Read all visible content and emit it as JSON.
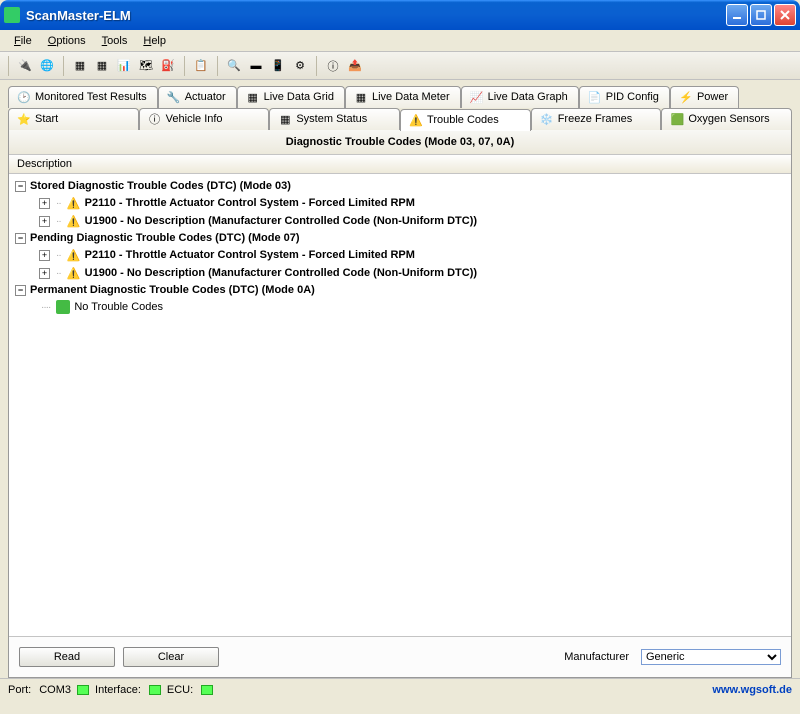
{
  "window": {
    "title": "ScanMaster-ELM"
  },
  "menu": {
    "file": "File",
    "options": "Options",
    "tools": "Tools",
    "help": "Help"
  },
  "tabs_top": [
    "Monitored Test Results",
    "Actuator",
    "Live Data Grid",
    "Live Data Meter",
    "Live Data Graph",
    "PID Config",
    "Power"
  ],
  "tabs_bottom": [
    "Start",
    "Vehicle Info",
    "System Status",
    "Trouble Codes",
    "Freeze Frames",
    "Oxygen Sensors"
  ],
  "panel": {
    "title": "Diagnostic Trouble Codes (Mode 03, 07, 0A)",
    "column": "Description"
  },
  "tree": {
    "group1": "Stored Diagnostic Trouble Codes (DTC) (Mode 03)",
    "g1_item1": "P2110 - Throttle Actuator Control System - Forced Limited RPM",
    "g1_item2": "U1900 - No Description (Manufacturer Controlled Code (Non-Uniform DTC))",
    "group2": "Pending Diagnostic Trouble Codes (DTC) (Mode 07)",
    "g2_item1": "P2110 - Throttle Actuator Control System - Forced Limited RPM",
    "g2_item2": "U1900 - No Description (Manufacturer Controlled Code (Non-Uniform DTC))",
    "group3": "Permanent Diagnostic Trouble Codes (DTC) (Mode 0A)",
    "g3_item1": "No Trouble Codes"
  },
  "buttons": {
    "read": "Read",
    "clear": "Clear"
  },
  "manufacturer": {
    "label": "Manufacturer",
    "value": "Generic"
  },
  "status": {
    "port_label": "Port:",
    "port_value": "COM3",
    "iface_label": "Interface:",
    "ecu_label": "ECU:",
    "url": "www.wgsoft.de"
  }
}
